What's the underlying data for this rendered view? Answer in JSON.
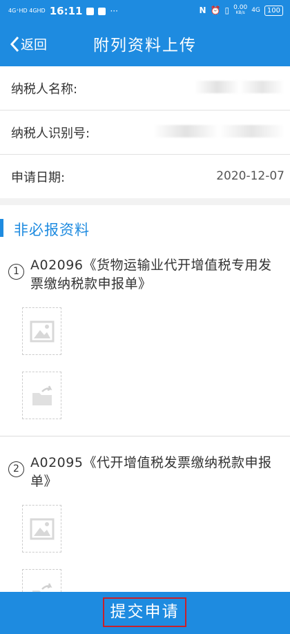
{
  "status_bar": {
    "network": "4G⁺HD 4GHD",
    "time": "16:11",
    "more": "···",
    "speed": "0.00",
    "speed_unit": "KB/s",
    "net_right": "4G",
    "battery": "100"
  },
  "nav": {
    "back_label": "返回",
    "title": "附列资料上传"
  },
  "info": {
    "taxpayer_name_label": "纳税人名称:",
    "taxpayer_id_label": "纳税人识别号:",
    "apply_date_label": "申请日期:",
    "apply_date_value": "2020-12-07"
  },
  "section": {
    "title": "非必报资料",
    "items": [
      {
        "num": "1",
        "name": "A02096《货物运输业代开增值税专用发票缴纳税款申报单》"
      },
      {
        "num": "2",
        "name": "A02095《代开增值税发票缴纳税款申报单》"
      }
    ]
  },
  "submit": {
    "label": "提交申请"
  },
  "colors": {
    "accent": "#1e8be0",
    "submit_border": "#c8202a"
  }
}
